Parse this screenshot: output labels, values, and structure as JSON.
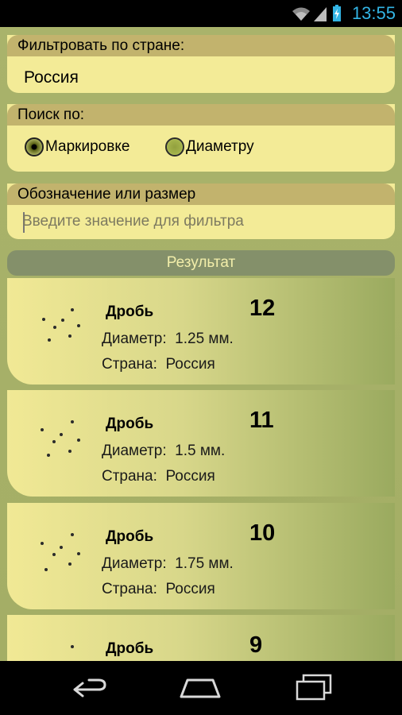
{
  "status_bar": {
    "time": "13:55",
    "icons": [
      "wifi-icon",
      "signal-icon",
      "battery-icon"
    ],
    "accent_color": "#33b5e5"
  },
  "filter_country": {
    "label": "Фильтровать по стране:",
    "value": "Россия"
  },
  "search_by": {
    "label": "Поиск по:",
    "options": [
      {
        "label": "Маркировке",
        "selected": true
      },
      {
        "label": "Диаметру",
        "selected": false
      }
    ]
  },
  "designation": {
    "label": "Обозначение или размер",
    "placeholder": "Введите значение для фильтра"
  },
  "result_header": "Результат",
  "results": [
    {
      "title": "Дробь",
      "number": "12",
      "diameter_label": "Диаметр:",
      "diameter_value": "1.25 мм.",
      "country_label": "Страна:",
      "country_value": "Россия"
    },
    {
      "title": "Дробь",
      "number": "11",
      "diameter_label": "Диаметр:",
      "diameter_value": "1.5 мм.",
      "country_label": "Страна:",
      "country_value": "Россия"
    },
    {
      "title": "Дробь",
      "number": "10",
      "diameter_label": "Диаметр:",
      "diameter_value": "1.75 мм.",
      "country_label": "Страна:",
      "country_value": "Россия"
    },
    {
      "title": "Дробь",
      "number": "9"
    }
  ],
  "nav_bar": {
    "buttons": [
      "back-icon",
      "home-icon",
      "recent-apps-icon"
    ]
  },
  "colors": {
    "panel_bg": "#f3eb97",
    "panel_label_bg": "#c2b36d",
    "result_header_bg": "#84906a",
    "app_bg": "#a9b36a"
  }
}
